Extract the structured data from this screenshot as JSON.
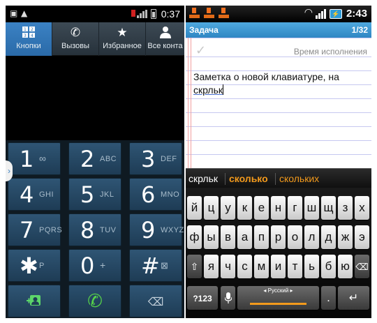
{
  "dialer": {
    "status": {
      "time": "0:37"
    },
    "tabs": [
      {
        "label": "Кнопки",
        "icon": "keypad-icon"
      },
      {
        "label": "Вызовы",
        "icon": "call-log-icon"
      },
      {
        "label": "Избранное",
        "icon": "star-icon"
      },
      {
        "label": "Все конта",
        "icon": "person-icon"
      }
    ],
    "keys": [
      {
        "digit": "1",
        "letters": "∞"
      },
      {
        "digit": "2",
        "letters": "ABC"
      },
      {
        "digit": "3",
        "letters": "DEF"
      },
      {
        "digit": "4",
        "letters": "GHI"
      },
      {
        "digit": "5",
        "letters": "JKL"
      },
      {
        "digit": "6",
        "letters": "MNO"
      },
      {
        "digit": "7",
        "letters": "PQRS"
      },
      {
        "digit": "8",
        "letters": "TUV"
      },
      {
        "digit": "9",
        "letters": "WXYZ"
      },
      {
        "digit": "✱",
        "letters": "P"
      },
      {
        "digit": "0",
        "letters": "+"
      },
      {
        "digit": "#",
        "letters": "⊠"
      }
    ],
    "accent_color": "#3b82c4",
    "call_color": "#56d14a"
  },
  "note": {
    "status": {
      "time": "2:43"
    },
    "title": "Задача",
    "page_counter": "1/32",
    "due_label": "Время исполнения",
    "text_line1": "Заметка о новой клавиатуре, на",
    "text_line2": "скрльк",
    "suggestions": [
      "скрльк",
      "сколько",
      "скольких"
    ],
    "keyboard": {
      "row1": [
        "й",
        "ц",
        "у",
        "к",
        "е",
        "н",
        "г",
        "ш",
        "щ",
        "з",
        "х"
      ],
      "row2": [
        "ф",
        "ы",
        "в",
        "а",
        "п",
        "р",
        "о",
        "л",
        "д",
        "ж",
        "э"
      ],
      "row3": [
        "я",
        "ч",
        "с",
        "м",
        "и",
        "т",
        "ь",
        "б",
        "ю"
      ],
      "symbols_label": "?123",
      "space_label": "◂ Русский ▸",
      "period_label": "."
    },
    "accent_color": "#f39a1c",
    "title_bar_color": "#2f86c3"
  }
}
